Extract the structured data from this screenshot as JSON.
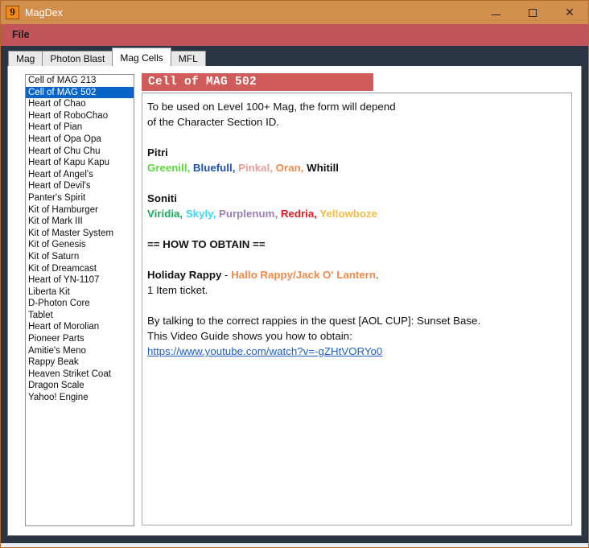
{
  "window": {
    "title": "MagDex",
    "icon": "app-logo-icon",
    "icon_glyph": "9",
    "titlebar_color": "#d28e4c",
    "menubar_color": "#c2555a",
    "controls": {
      "minimize": "minimize-icon",
      "maximize": "maximize-icon",
      "close": "close-icon"
    }
  },
  "menubar": {
    "items": [
      "File"
    ]
  },
  "tabs": [
    {
      "label": "Mag",
      "active": false
    },
    {
      "label": "Photon Blast",
      "active": false
    },
    {
      "label": "Mag Cells",
      "active": true
    },
    {
      "label": "MFL",
      "active": false
    }
  ],
  "list": {
    "selected_index": 1,
    "items": [
      "Cell of MAG 213",
      "Cell of MAG 502",
      "Heart of Chao",
      "Heart of RoboChao",
      "Heart of Pian",
      "Heart of Opa Opa",
      "Heart of Chu Chu",
      "Heart of Kapu Kapu",
      "Heart of Angel's",
      "Heart of Devil's",
      "Panter's Spirit",
      "Kit of Hamburger",
      "Kit of Mark III",
      "Kit of Master System",
      "Kit of Genesis",
      "Kit of Saturn",
      "Kit of Dreamcast",
      "Heart of YN-1107",
      "Liberta Kit",
      "D-Photon Core",
      "Tablet",
      "Heart of Morolian",
      "Pioneer Parts",
      "Amitie's Meno",
      "Rappy Beak",
      "Heaven Striket Coat",
      "Dragon Scale",
      "Yahoo! Engine"
    ]
  },
  "detail": {
    "header": "Cell of MAG 502",
    "header_bg": "#cf5b5b",
    "intro_line1": "To be used on Level 100+ Mag, the form will depend",
    "intro_line2": "of the Character Section ID.",
    "pitri": {
      "title": "Pitri",
      "ids": [
        {
          "name": "Greenill",
          "color": "#5cd63c"
        },
        {
          "name": "Bluefull",
          "color": "#1c4fb0"
        },
        {
          "name": "Pinkal",
          "color": "#e89a96"
        },
        {
          "name": "Oran",
          "color": "#ef8848"
        },
        {
          "name": "Whitill",
          "color": "#111111"
        }
      ]
    },
    "soniti": {
      "title": "Soniti",
      "ids": [
        {
          "name": "Viridia",
          "color": "#19a85c"
        },
        {
          "name": "Skyly",
          "color": "#3ad6ee"
        },
        {
          "name": "Purplenum",
          "color": "#9b7fb4"
        },
        {
          "name": "Redria",
          "color": "#e01b24"
        },
        {
          "name": "Yellowboze",
          "color": "#efbc46"
        }
      ]
    },
    "how_to_obtain_heading": "== HOW TO OBTAIN ==",
    "obtain": {
      "source_label": "Holiday Rappy",
      "dash": " - ",
      "enemy": "Hallo Rappy/Jack O' Lantern",
      "enemy_color": "#ef8848",
      "period": ".",
      "cost": "1 Item ticket."
    },
    "quest_line1": "By talking to the correct rappies in the quest [AOL CUP]: Sunset Base.",
    "quest_line2": "This Video Guide shows you how to obtain:",
    "video_url": "https://www.youtube.com/watch?v=-gZHtVORYo0"
  }
}
